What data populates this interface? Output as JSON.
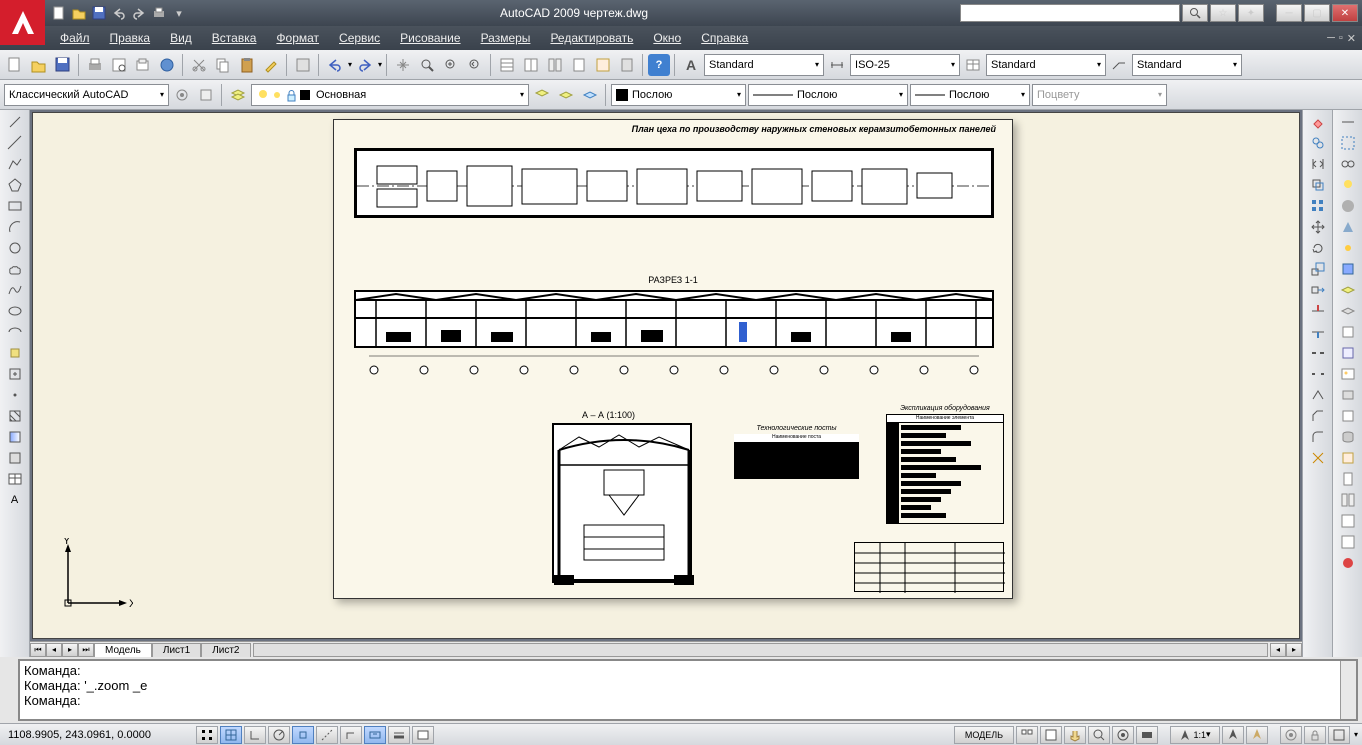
{
  "title": "AutoCAD 2009 чертеж.dwg",
  "menu": [
    "Файл",
    "Правка",
    "Вид",
    "Вставка",
    "Формат",
    "Сервис",
    "Рисование",
    "Размеры",
    "Редактировать",
    "Окно",
    "Справка"
  ],
  "workspace": "Классический AutoCAD",
  "layer": "Основная",
  "textStyle": "Standard",
  "dimStyle": "ISO-25",
  "tableStyle": "Standard",
  "mlStyle": "Standard",
  "color": "Послою",
  "linetype": "Послою",
  "lineweight": "Послою",
  "plotStyle": "Поцвету",
  "tabs": {
    "model": "Модель",
    "l1": "Лист1",
    "l2": "Лист2"
  },
  "cmd": {
    "l1": "Команда:",
    "l2": "Команда: '_.zoom _e",
    "l3": "Команда:"
  },
  "coords": "1108.9905, 243.0961, 0.0000",
  "status": {
    "model": "МОДЕЛЬ",
    "scale": "1:1"
  },
  "drawing": {
    "title": "План цеха по производству наружных стеновых керамзитобетонных панелей",
    "section11": "РАЗРЕЗ 1-1",
    "sectionAA": "А – А (1:100)",
    "techPosts": "Технологические посты",
    "techPostsSub": "Наименование поста",
    "equipTitle": "Экспликация оборудования",
    "equipCol": "Наименование элемента",
    "ucsX": "X",
    "ucsY": "Y"
  }
}
